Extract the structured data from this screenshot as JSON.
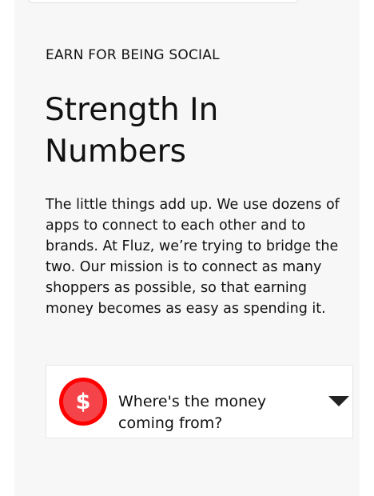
{
  "section": {
    "eyebrow": "EARN FOR BEING SOCIAL",
    "title": "Strength In Numbers",
    "body": "The little things add up. We use dozens of apps to connect to each other and to brands. At Fluz, we’re trying to bridge the two. Our mission is to connect as many shoppers as possible, so that earning money becomes as easy as spending it."
  },
  "faq": {
    "icon_glyph": "$",
    "question": "Where's the money coming from?",
    "icon_color": "#ff0000"
  }
}
